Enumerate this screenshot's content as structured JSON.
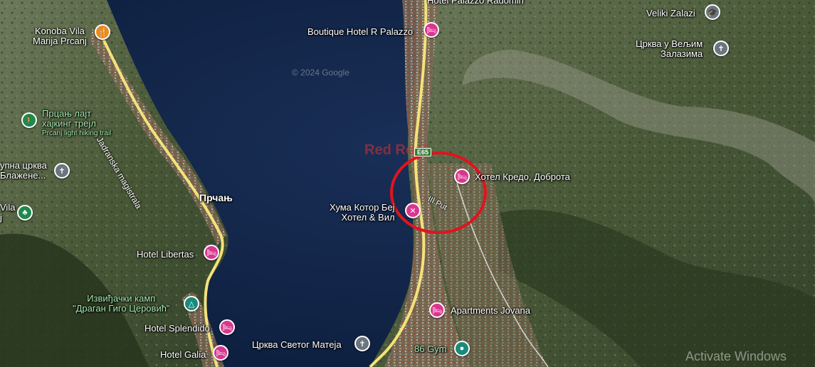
{
  "map": {
    "colors": {
      "sea": "#0f2447",
      "land_dark": "#3b4a2c",
      "land_mid": "#5b6a4a",
      "rock": "#8a8f80",
      "road": "#f3e27a",
      "circle": "#e0141e",
      "hotel_pin": "#d9368f"
    },
    "places": {
      "konoba": "Konoba Vila\nMarija Prcanj",
      "boutique": "Boutique Hotel R Palazzo",
      "top_cut": "Hotel Palazzo Radomiri",
      "veliki": "Veliki Zalazi",
      "crkva_velji": "Црква у Вељим\nЗалазима",
      "trail_cyr": "Прцањ лајт\nхајкинг трејл",
      "trail_lat": "Prcanj light hiking trail",
      "church_left": "упна црква\nБлажене...",
      "vila_left": "Vila\nj",
      "prcanj": "Прчањ",
      "libertas": "Hotel Libertas",
      "kamp": "Извиђачки камп\n\"Драган Гиго Церовић\"",
      "splendido": "Hotel Splendido",
      "galia": "Hotel Galia",
      "kredo": "Хотел Кредо, Доброта",
      "huma": "Хума Котор Беј\nХотел & Вил",
      "jovana": "Apartments Jovana",
      "crkva_mateja": "Црква Светог Матеја",
      "gym": "86 Gym",
      "road": "Jadranska magistrala",
      "put": "III Put",
      "route_shield": "E65"
    },
    "overlay": {
      "brand": "Red Rock",
      "copyright": "© 2024 Google",
      "windows": "Activate Windows"
    },
    "icons": {
      "hotel": "bed-icon",
      "food": "restaurant-icon",
      "hiking": "hiking-icon",
      "church": "cross-icon",
      "park": "tree-icon",
      "camp": "campground-icon",
      "gym": "gym-icon",
      "school": "school-icon"
    }
  }
}
